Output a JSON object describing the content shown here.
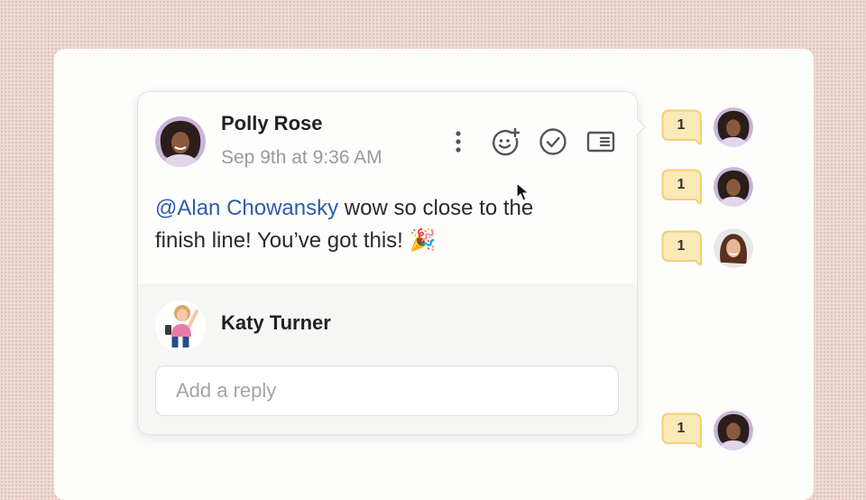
{
  "comment": {
    "author": "Polly Rose",
    "timestamp": "Sep 9th at 9:36 AM",
    "mention": "@Alan Chowansky",
    "body_line1": " wow so close to the",
    "body_line2": "finish line! You’ve got this! 🎉",
    "toolbar": {
      "more": "more-options",
      "react": "add-reaction",
      "resolve": "resolve",
      "sidebar": "open-in-sidebar"
    }
  },
  "reply": {
    "author": "Katy Turner",
    "placeholder": "Add a reply"
  },
  "markers": [
    {
      "count": "1",
      "avatar": "polly-rose"
    },
    {
      "count": "1",
      "avatar": "polly-rose"
    },
    {
      "count": "1",
      "avatar": "user-long-hair"
    },
    {
      "count": "1",
      "avatar": "polly-rose"
    }
  ],
  "colors": {
    "mention": "#2f5ea8",
    "bubble_fill": "#fbe9b7",
    "bubble_border": "#f2cf78",
    "background": "#efd9d3"
  }
}
